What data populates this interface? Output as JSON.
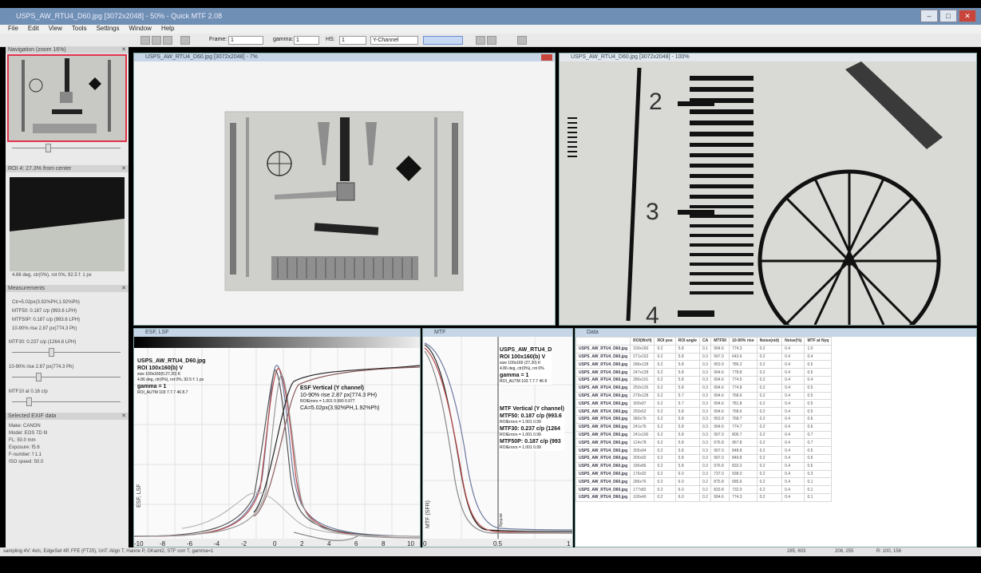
{
  "window": {
    "title": "USPS_AW_RTU4_D60.jpg [3072x2048] - 50% - Quick MTF 2.08"
  },
  "menu": [
    "File",
    "Edit",
    "View",
    "Tools",
    "Settings",
    "Window",
    "Help"
  ],
  "toolbar": {
    "frame_label": "Frame:",
    "frame_value": "1",
    "gamma_label": "gamma:",
    "gamma_value": "1",
    "hs_label": "HS:",
    "hs_value": "1",
    "channel": "Y-Channel"
  },
  "panels": {
    "navigation": {
      "title": "Navigation (zoom 16%)"
    },
    "roi": {
      "title": "ROI 4: 27.3% from center",
      "caption": "4.86 deg, ctr(0%), rot 0%, 92.5 f: 1 px"
    },
    "measurements": {
      "title": "Measurements",
      "lines": [
        "Ctr=5.02px(3.92%PH,1.92%Ph)",
        "MTF50: 0.187 c/p (993.6 LPH)",
        "MTF50P: 0.187 c/p (993.6 LPH)",
        "10-90% rise 2.87 px(774.3 Ph)"
      ],
      "sliders": [
        "MTF30: 0.237 c/p (1264.8 LPH)",
        "10-90% rise 2.87 px(774.3 Ph)",
        "MTF10 at 0.16 c/p"
      ]
    },
    "exif": {
      "title": "Selected EXIF data",
      "lines": [
        "Make: CANON",
        "Model: EOS 7D III",
        "FL: 50.0 mm",
        "Exposure: f5.6",
        "F-number: f 1.1",
        "ISO speed: 50.0"
      ]
    }
  },
  "image_window": {
    "title": "USPS_AW_RTU4_D60.jpg [3072x2048] - 7%"
  },
  "zoom_window": {
    "title": "USPS_AW_RTU4_D60.jpg [3072x2048] - 100%",
    "scale_labels": [
      "2",
      "3",
      "4"
    ]
  },
  "esf_window": {
    "title": "ESF, LSF",
    "info_lines": [
      "USPS_AW_RTU4_D60.jpg",
      "ROI 100x160(b) V",
      "size 100x160(0.27,20) K",
      "4.86 deg, ctr(0%), rot 0%, 92.5 f: 1 px",
      "gamma = 1",
      "ROI_AUTM 103 7.7.7 46 8.7"
    ],
    "annot_lines": [
      "ESF Vertical (Y channel)",
      "10-90% rise 2.87 px(774.3 PH)",
      "ROIErrors = 1.001 0.990 0.977",
      "CA=5.02px(3.92%PH,1.92%Ph)"
    ],
    "ylabel": "ESF, LSF",
    "xticks": [
      "-10",
      "-8",
      "-6",
      "-4",
      "-2",
      "0",
      "2",
      "4",
      "6",
      "8",
      "10"
    ]
  },
  "mtf_window": {
    "title": "MTF",
    "info_lines": [
      "USPS_AW_RTU4_D",
      "ROI 100x160(b) V",
      "size 100x160 (27,20) K",
      "4.86 deg, ctr(0%), rot 0%",
      "gamma = 1",
      "ROI_AUTM 103 7.7.7 46 8"
    ],
    "annot_lines": [
      "MTF Vertical (Y channel)",
      "MTF50: 0.187 c/p (993.6",
      "ROIErrors = 1.001 0.99",
      "MTF30: 0.237 c/p (1264",
      "ROIErrors = 1.001 0.99",
      "MTF50P: 0.187 c/p (993",
      "ROIErrors = 1.001 0.99"
    ],
    "ylabel": "MTF (SFR)",
    "xticks": [
      "0",
      "0.5",
      "1"
    ],
    "nyquist": "Nyquist"
  },
  "data_window": {
    "title": "Data",
    "headers": [
      "",
      "ROI(WxH)",
      "ROI pos",
      "ROI angle",
      "CA",
      "MTF50",
      "10-90% rise",
      "Noise(std)",
      "Noise(%)",
      "MTF at Nyq"
    ],
    "rows": [
      [
        "USPS_AW_RTU4_D60.jpg",
        "100x160",
        "0.2",
        "5.8",
        "0.1",
        "994.6",
        "774.3",
        "0.2",
        "0.4",
        "1.0"
      ],
      [
        "USPS_AW_RTU4_D60.jpg",
        "271x152",
        "0.2",
        "5.8",
        "0.3",
        "997.0",
        "643.6",
        "0.2",
        "0.4",
        "0.4"
      ],
      [
        "USPS_AW_RTU4_D60.jpg",
        "286x128",
        "0.2",
        "5.8",
        "0.3",
        "953.9",
        "786.2",
        "0.2",
        "0.4",
        "0.5"
      ],
      [
        "USPS_AW_RTU4_D60.jpg",
        "247x128",
        "0.2",
        "5.8",
        "0.3",
        "994.6",
        "778.8",
        "0.2",
        "0.4",
        "0.5"
      ],
      [
        "USPS_AW_RTU4_D60.jpg",
        "286x101",
        "0.2",
        "5.8",
        "0.3",
        "994.6",
        "774.5",
        "0.2",
        "0.4",
        "0.4"
      ],
      [
        "USPS_AW_RTU4_D60.jpg",
        "250x126",
        "0.2",
        "5.8",
        "0.3",
        "994.6",
        "774.8",
        "0.2",
        "0.4",
        "0.5"
      ],
      [
        "USPS_AW_RTU4_D60.jpg",
        "279x128",
        "0.2",
        "5.7",
        "0.3",
        "994.6",
        "768.6",
        "0.2",
        "0.4",
        "0.5"
      ],
      [
        "USPS_AW_RTU4_D60.jpg",
        "300x97",
        "0.2",
        "5.7",
        "0.3",
        "994.6",
        "781.8",
        "0.2",
        "0.4",
        "0.5"
      ],
      [
        "USPS_AW_RTU4_D60.jpg",
        "250x52",
        "0.2",
        "5.8",
        "0.3",
        "994.6",
        "768.6",
        "0.2",
        "0.4",
        "0.5"
      ],
      [
        "USPS_AW_RTU4_D60.jpg",
        "380x76",
        "0.2",
        "5.8",
        "0.3",
        "953.9",
        "768.7",
        "0.2",
        "0.4",
        "0.6"
      ],
      [
        "USPS_AW_RTU4_D60.jpg",
        "241x76",
        "0.2",
        "5.8",
        "0.3",
        "994.6",
        "774.7",
        "0.2",
        "0.4",
        "0.6"
      ],
      [
        "USPS_AW_RTU4_D60.jpg",
        "241x100",
        "0.2",
        "5.8",
        "0.3",
        "997.0",
        "805.7",
        "0.2",
        "0.4",
        "0.7"
      ],
      [
        "USPS_AW_RTU4_D60.jpg",
        "124x78",
        "0.2",
        "5.8",
        "0.3",
        "976.8",
        "967.8",
        "0.2",
        "0.4",
        "0.7"
      ],
      [
        "USPS_AW_RTU4_D60.jpg",
        "305x94",
        "0.2",
        "5.8",
        "0.3",
        "997.0",
        "848.8",
        "0.2",
        "0.4",
        "0.5"
      ],
      [
        "USPS_AW_RTU4_D60.jpg",
        "305x92",
        "0.2",
        "5.8",
        "0.3",
        "997.0",
        "849.8",
        "0.2",
        "0.4",
        "0.6"
      ],
      [
        "USPS_AW_RTU4_D60.jpg",
        "186x86",
        "0.2",
        "5.8",
        "0.3",
        "976.8",
        "833.2",
        "0.2",
        "0.4",
        "0.6"
      ],
      [
        "USPS_AW_RTU4_D60.jpg",
        "176x92",
        "0.2",
        "6.0",
        "0.3",
        "737.0",
        "938.0",
        "0.2",
        "0.4",
        "0.3"
      ],
      [
        "USPS_AW_RTU4_D60.jpg",
        "286x76",
        "0.2",
        "6.0",
        "0.2",
        "875.8",
        "685.6",
        "0.2",
        "0.4",
        "0.1"
      ],
      [
        "USPS_AW_RTU4_D60.jpg",
        "177x82",
        "0.2",
        "6.0",
        "0.2",
        "833.8",
        "732.0",
        "0.2",
        "0.4",
        "0.1"
      ],
      [
        "USPS_AW_RTU4_D60.jpg",
        "100x40",
        "0.2",
        "6.0",
        "0.2",
        "994.6",
        "774.3",
        "0.2",
        "0.4",
        "0.1"
      ]
    ]
  },
  "status": {
    "left": "sampling 4V: 4x/c, EdgeSet 4P, FFE (FT25), UnT: Align T, Hanne P, GKaint2, STF corr T, gamma=1",
    "c1": "285, 603",
    "c2": "208, 255",
    "c3": "R: 100, 156"
  }
}
